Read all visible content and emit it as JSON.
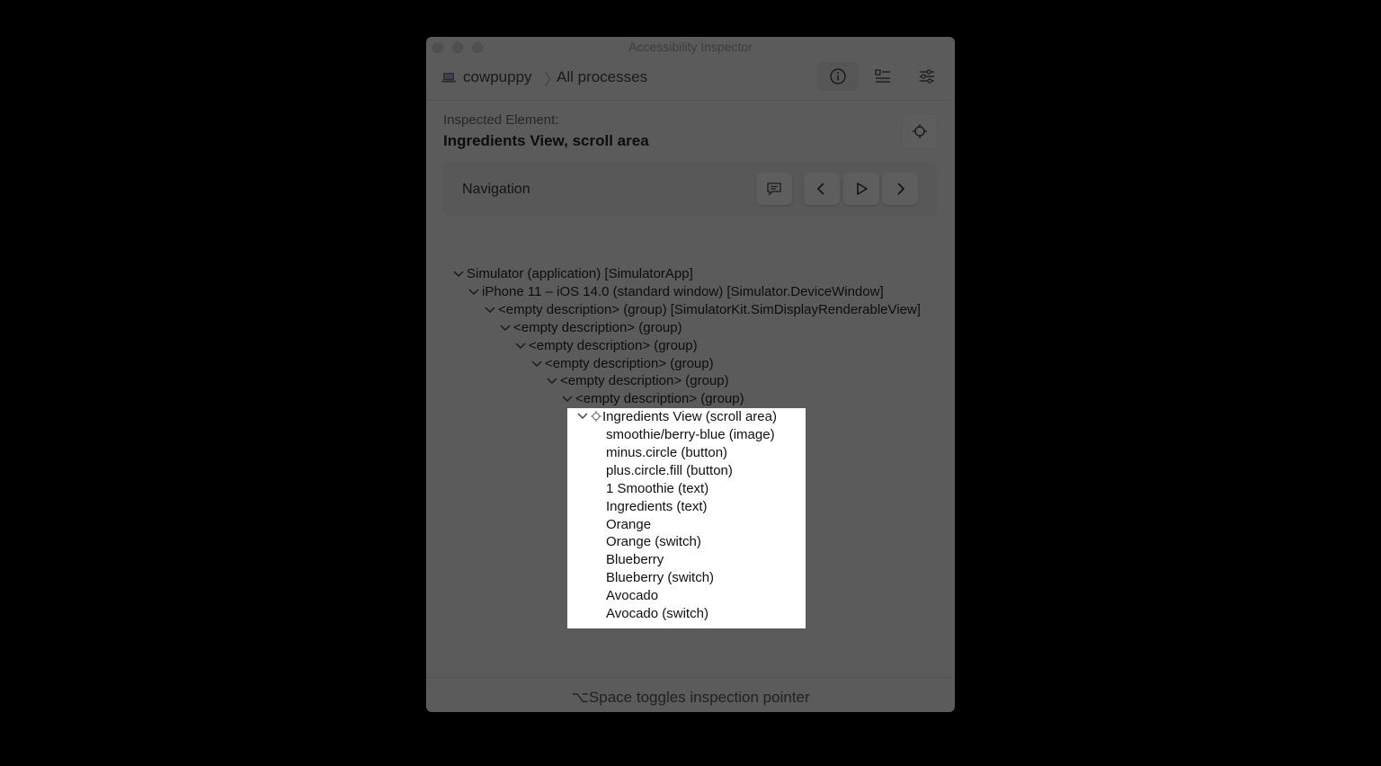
{
  "window": {
    "title": "Accessibility Inspector",
    "traffic_lights": [
      "close",
      "minimize",
      "zoom"
    ]
  },
  "toolbar": {
    "target_icon": "laptop-icon",
    "target_name": "cowpuppy",
    "separator": "〉",
    "process": "All processes",
    "buttons": [
      "info-icon",
      "audit-icon",
      "settings-icon"
    ]
  },
  "inspected": {
    "label": "Inspected Element:",
    "value": "Ingredients View, scroll area"
  },
  "navigation": {
    "title": "Navigation",
    "buttons": [
      "speech-bubble-icon",
      "chevron-left-icon",
      "play-icon",
      "chevron-right-icon"
    ]
  },
  "tree": [
    {
      "text": "Simulator (application) [SimulatorApp]"
    },
    {
      "text": "iPhone 11 – iOS 14.0 (standard window) [Simulator.DeviceWindow]"
    },
    {
      "text": "<empty description> (group) [SimulatorKit.SimDisplayRenderableView]"
    },
    {
      "text": "<empty description> (group)"
    },
    {
      "text": "<empty description> (group)"
    },
    {
      "text": "<empty description> (group)"
    },
    {
      "text": "<empty description> (group)"
    },
    {
      "text": "<empty description> (group)"
    }
  ],
  "selected_node": {
    "text": "Ingredients View (scroll area)",
    "children": [
      "smoothie/berry-blue (image)",
      "minus.circle (button)",
      "plus.circle.fill (button)",
      "1 Smoothie (text)",
      "Ingredients (text)",
      "Orange",
      "Orange (switch)",
      "Blueberry",
      "Blueberry (switch)",
      "Avocado",
      "Avocado (switch)"
    ]
  },
  "footer": {
    "hint": "⌥Space toggles inspection pointer"
  }
}
